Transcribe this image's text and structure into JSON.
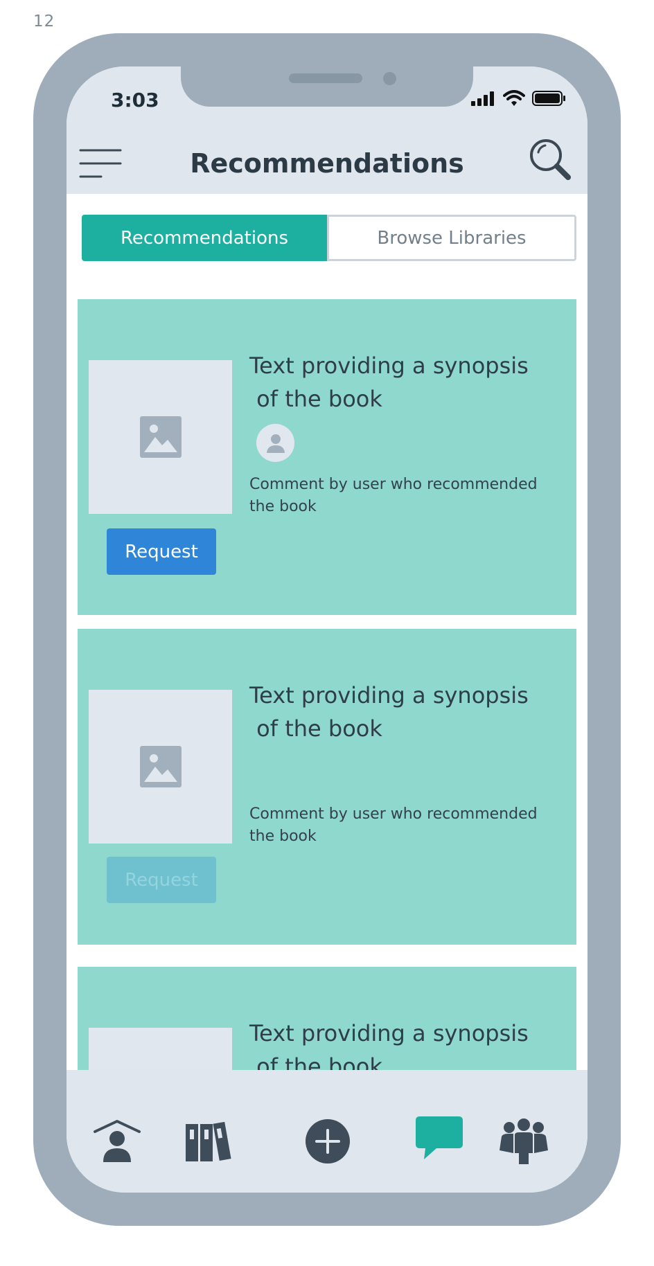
{
  "page_number": "12",
  "status": {
    "time": "3:03"
  },
  "header": {
    "title": "Recommendations"
  },
  "tabs": [
    {
      "label": "Recommendations",
      "active": true
    },
    {
      "label": "Browse Libraries",
      "active": false
    }
  ],
  "cards": [
    {
      "synopsis": "Text providing a synopsis\n of the book",
      "comment": "Comment by user who recommended the book",
      "request_label": "Request",
      "request_enabled": true
    },
    {
      "synopsis": "Text providing a synopsis\n of the book",
      "comment": "Comment by user who recommended the book",
      "request_label": "Request",
      "request_enabled": false
    },
    {
      "synopsis": "Text providing a synopsis\n of the book"
    }
  ],
  "bottom_nav": [
    {
      "icon": "home-user-icon"
    },
    {
      "icon": "library-books-icon"
    },
    {
      "icon": "add-icon"
    },
    {
      "icon": "chat-icon",
      "active": true
    },
    {
      "icon": "group-icon"
    }
  ],
  "colors": {
    "accent": "#1db0a0",
    "card": "#8fd8ce",
    "request_button": "#2f86d9",
    "request_button_disabled": "#6fc1d0",
    "frame": "#9eadb9",
    "header_bg": "#e0e6ee"
  }
}
